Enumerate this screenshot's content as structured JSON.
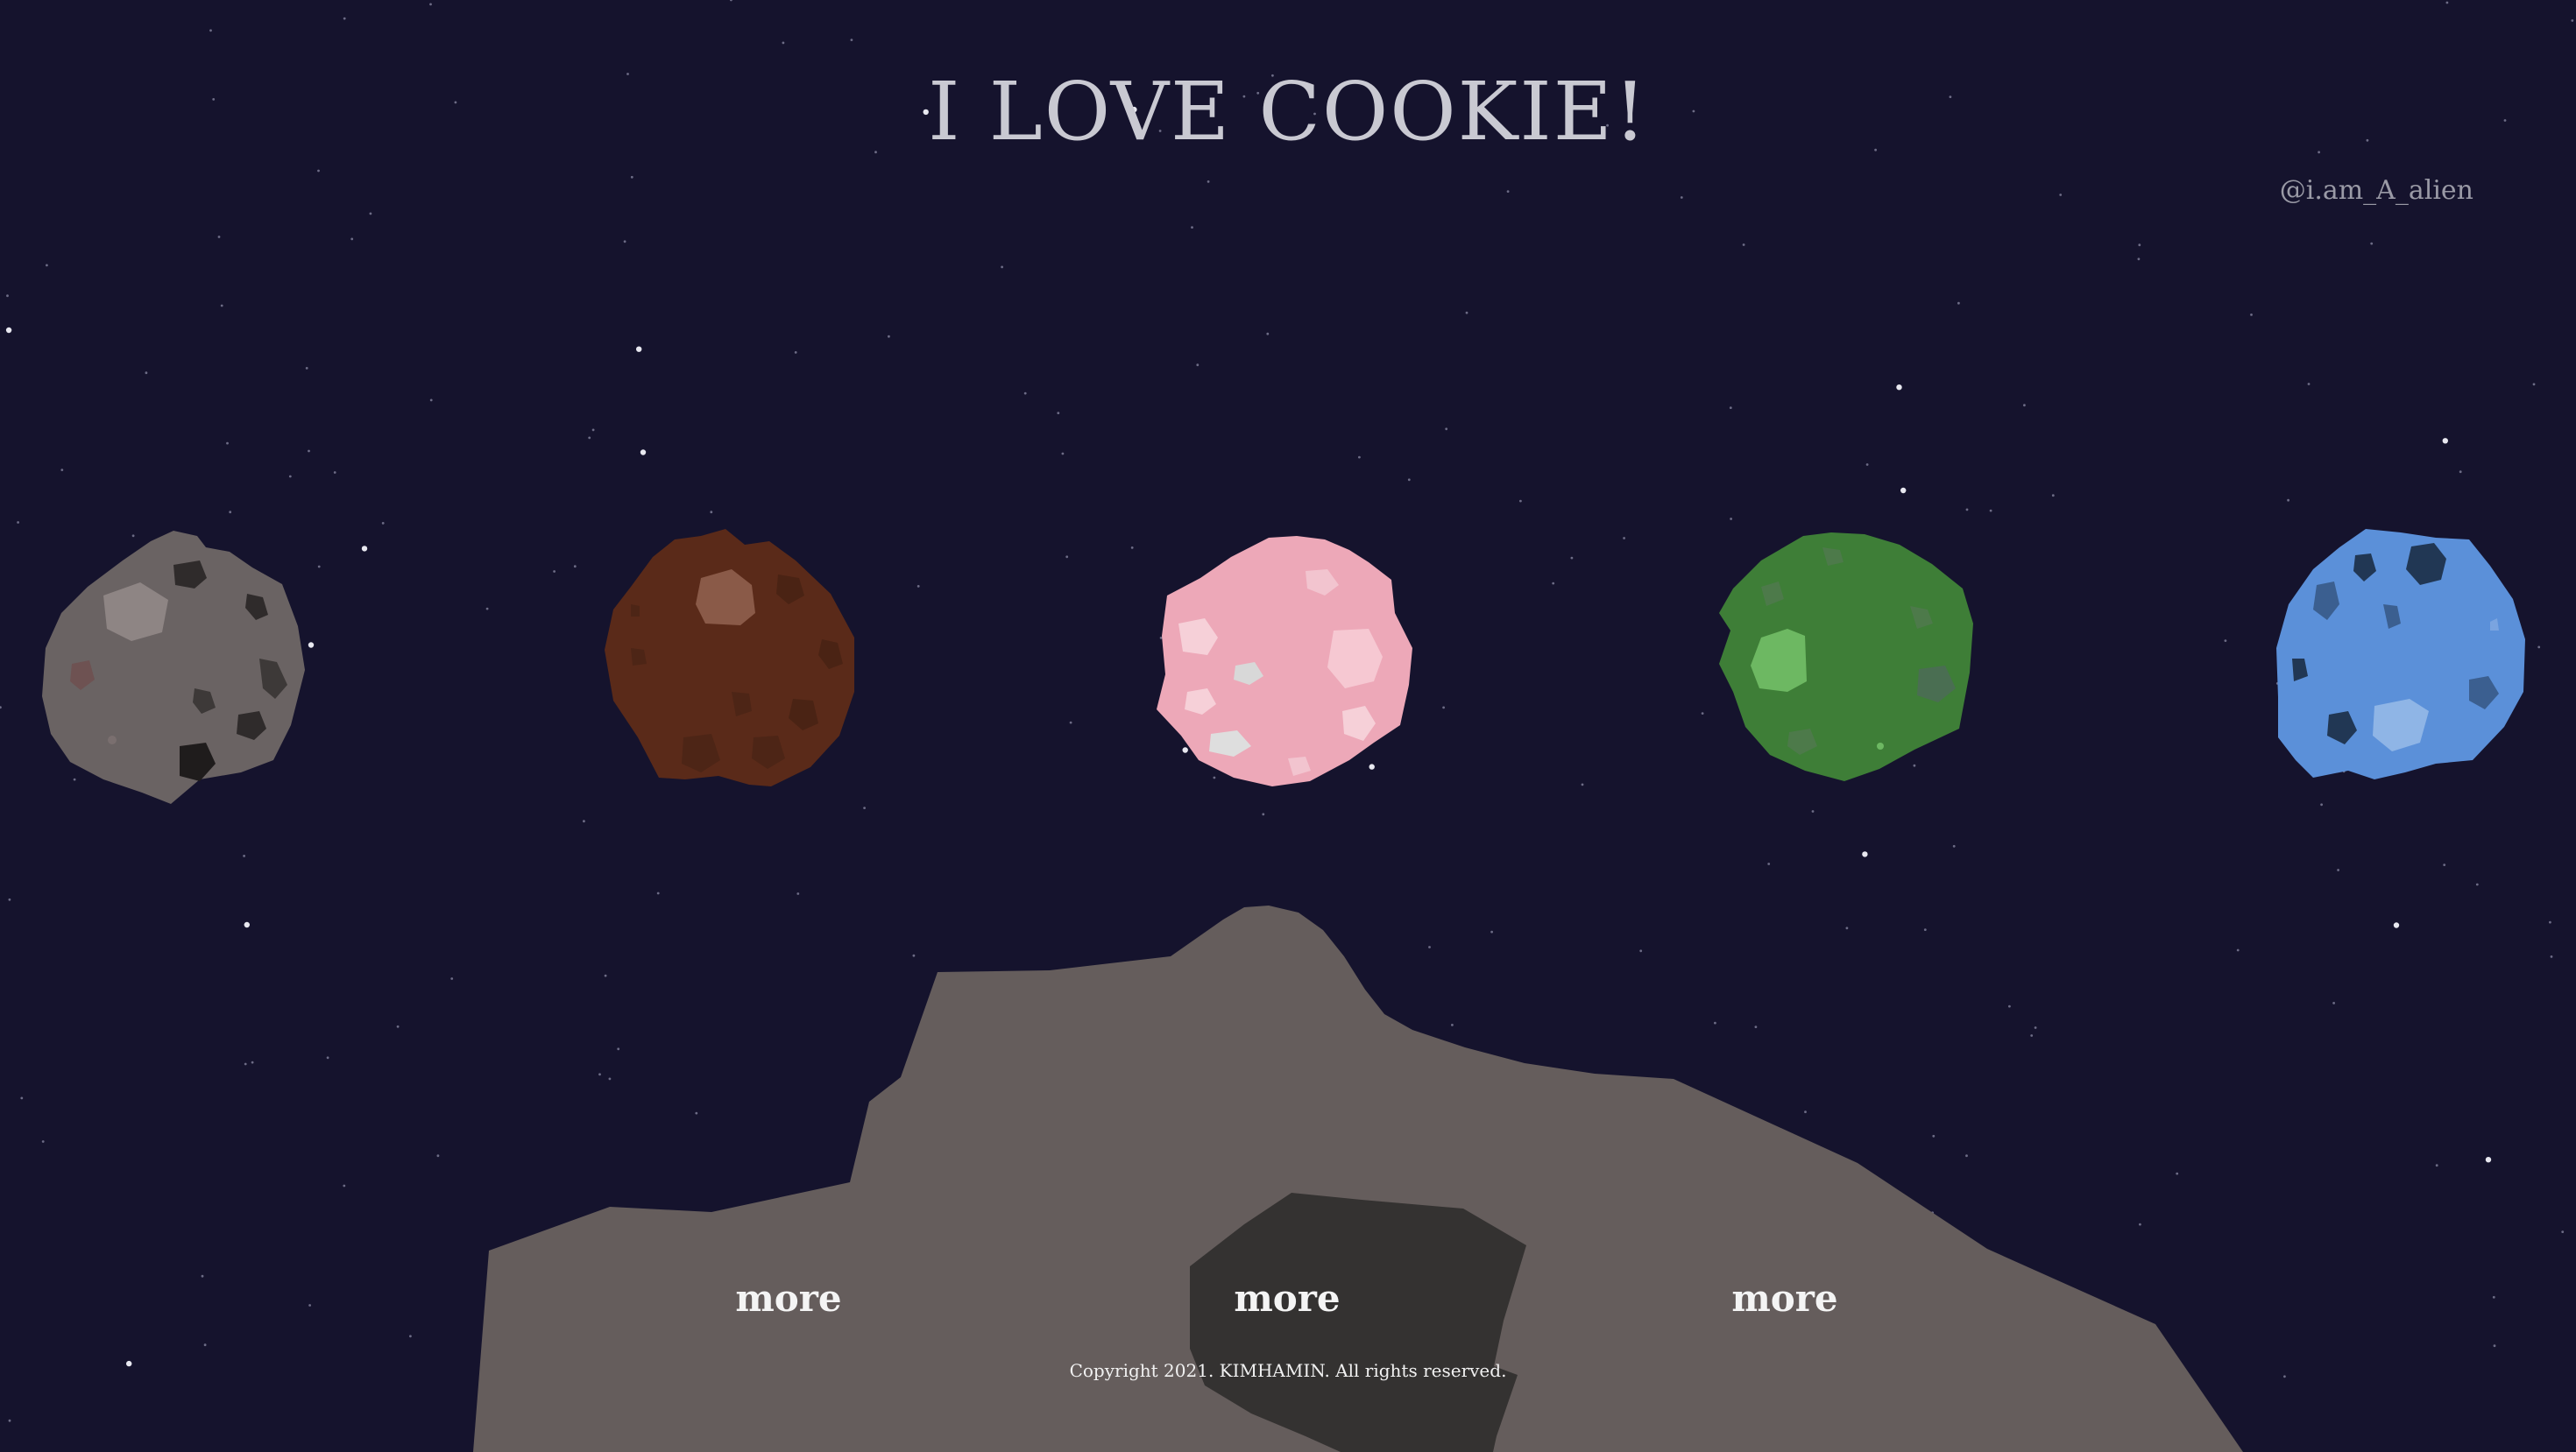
{
  "header": {
    "title": "I LOVE COOKIE!",
    "handle": "@i.am_A_alien"
  },
  "planets": [
    {
      "name": "gray-cookie",
      "color": "#6a6363"
    },
    {
      "name": "chocolate-cookie",
      "color": "#5a2a19"
    },
    {
      "name": "pink-cookie",
      "color": "#eda8b8"
    },
    {
      "name": "green-cookie",
      "color": "#3e7e37"
    },
    {
      "name": "blue-cookie",
      "color": "#5b90d9"
    }
  ],
  "links": {
    "more_1": "more",
    "more_2": "more",
    "more_3": "more"
  },
  "footer": {
    "copyright": "Copyright 2021. KIMHAMIN. All rights reserved."
  },
  "colors": {
    "background": "#15132d",
    "rock": "#655d5c",
    "crater": "#343231"
  }
}
